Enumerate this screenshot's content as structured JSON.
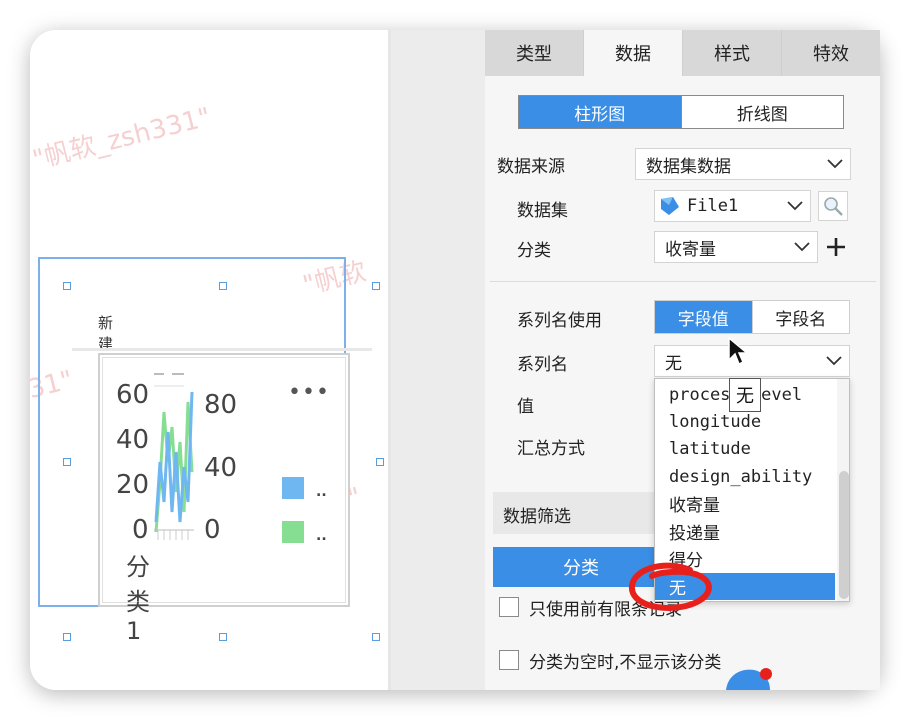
{
  "watermark": "\"帆软_zsh331\"",
  "watermark_short": "\"帆软",
  "widget": {
    "title": "新建标题",
    "left_axis_ticks": [
      "60",
      "40",
      "20",
      "0"
    ],
    "right_axis_ticks": [
      "80",
      "40",
      "0"
    ],
    "category_label": "分类1",
    "more": "•••",
    "legend": [
      {
        "color": "#6fb7f0",
        "label": ".."
      },
      {
        "color": "#86de93",
        "label": ".."
      }
    ]
  },
  "tabs": [
    {
      "label": "类型"
    },
    {
      "label": "数据"
    },
    {
      "label": "样式"
    },
    {
      "label": "特效"
    }
  ],
  "chart_type_toggle": {
    "left": "柱形图",
    "right": "折线图"
  },
  "data_source": {
    "label": "数据来源",
    "value": "数据集数据"
  },
  "dataset": {
    "label": "数据集",
    "value": "File1"
  },
  "category": {
    "label": "分类",
    "value": "收寄量"
  },
  "series_name_use": {
    "label": "系列名使用",
    "option_a": "字段值",
    "option_b": "字段名"
  },
  "series_name": {
    "label": "系列名",
    "value": "无"
  },
  "value_field": {
    "label": "值"
  },
  "summary": {
    "label": "汇总方式"
  },
  "filter": {
    "label": "数据筛选",
    "button": "分类"
  },
  "dropdown_items": [
    "process_level",
    "longitude",
    "latitude",
    "design_ability",
    "收寄量",
    "投递量",
    "得分",
    "无"
  ],
  "tooltip": "无",
  "options": {
    "limit_label": "只使用前有限条记录",
    "empty_category_label": "分类为空时,不显示该分类"
  },
  "colors": {
    "accent": "#3a8ee6",
    "annotation": "#e8201c",
    "series_blue": "#6fb7f0",
    "series_green": "#86de93"
  }
}
